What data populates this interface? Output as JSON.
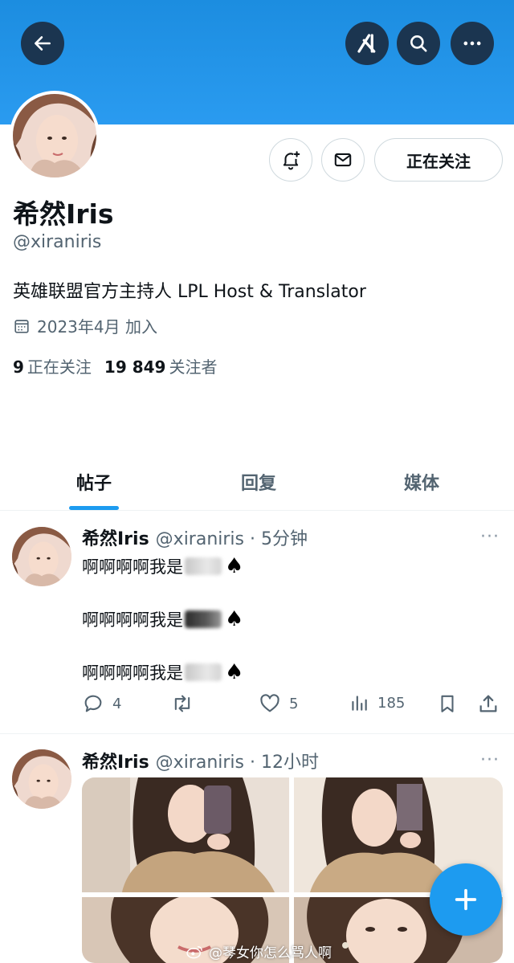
{
  "profile": {
    "name": "希然Iris",
    "handle": "@xiraniris",
    "bio": "英雄联盟官方主持人 LPL Host & Translator",
    "joined": "2023年4月 加入",
    "following_count": "9",
    "following_label": "正在关注",
    "followers_count": "19 849",
    "followers_label": "关注者",
    "follow_button_label": "正在关注"
  },
  "tabs": [
    {
      "label": "帖子",
      "active": true
    },
    {
      "label": "回复",
      "active": false
    },
    {
      "label": "媒体",
      "active": false
    }
  ],
  "posts": [
    {
      "author": "希然Iris",
      "meta": "@xiraniris · 5分钟",
      "lines": [
        "啊啊啊啊我是",
        "啊啊啊啊我是",
        "啊啊啊啊我是"
      ],
      "spade": "♠",
      "replies": "4",
      "likes": "5",
      "views": "185"
    },
    {
      "author": "希然Iris",
      "meta": "@xiraniris · 12小时"
    }
  ],
  "more_glyph": "···",
  "watermark": "@琴女你怎么骂人啊",
  "colors": {
    "accent": "#1d9bf0",
    "banner": "#2a9bf0",
    "secondary_text": "#536471"
  }
}
